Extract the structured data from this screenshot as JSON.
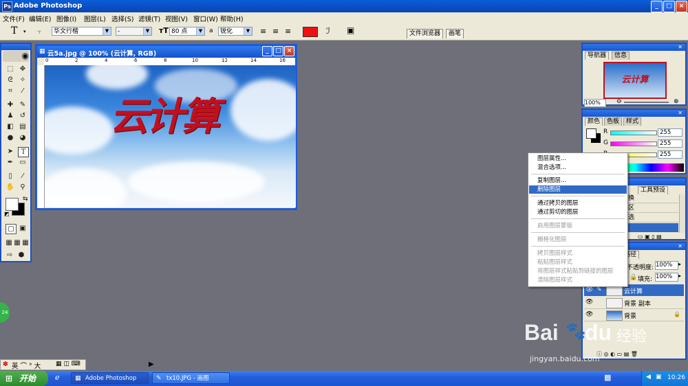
{
  "app": {
    "title": "Adobe Photoshop",
    "window_buttons": [
      "_",
      "□",
      "×"
    ]
  },
  "menu": [
    "文件(F)",
    "编辑(E)",
    "图像(I)",
    "图层(L)",
    "选择(S)",
    "滤镜(T)",
    "视图(V)",
    "窗口(W)",
    "帮助(H)"
  ],
  "options": {
    "tool_glyph": "T",
    "font_family": "华文行楷",
    "font_style": "-",
    "font_size": "80 点",
    "aa_label": "a",
    "antialias": "锐化",
    "text_color": "#ee1111",
    "file_browser": "文件浏览器",
    "brushes": "画笔"
  },
  "document": {
    "title": "云5a.jpg @ 100% (云计算, RGB)",
    "ruler_marks": [
      "0",
      "2",
      "4",
      "6",
      "8",
      "10",
      "12",
      "14",
      "16"
    ],
    "canvas_text": "云计算"
  },
  "navigator": {
    "tabs": [
      "导航器",
      "信息"
    ],
    "zoom": "100%",
    "preview_text": "云计算"
  },
  "color_panel": {
    "tabs": [
      "颜色",
      "色板",
      "样式"
    ],
    "channels": [
      {
        "label": "R",
        "value": "255"
      },
      {
        "label": "G",
        "value": "255"
      },
      {
        "label": "B",
        "value": "255"
      }
    ]
  },
  "history_panel": {
    "tabs": [
      "工具预设"
    ],
    "items": [
      "换",
      "区",
      "选"
    ]
  },
  "layers_panel": {
    "tab": "路径",
    "opacity_label": "不透明度:",
    "opacity": "100%",
    "fill_label": "填充:",
    "fill": "100%",
    "layers": [
      {
        "name": "云计算",
        "selected": true
      },
      {
        "name": "背景 副本",
        "selected": false
      },
      {
        "name": "背景",
        "selected": false
      }
    ]
  },
  "context_menu": {
    "items": [
      {
        "label": "图层属性...",
        "disabled": false
      },
      {
        "label": "混合选项...",
        "disabled": false
      },
      {
        "label": "复制图层...",
        "disabled": false
      },
      {
        "label": "删除图层",
        "disabled": false,
        "selected": true
      },
      {
        "label": "通过拷贝的图层",
        "disabled": false
      },
      {
        "label": "通过剪切的图层",
        "disabled": false
      },
      {
        "label": "启用图层蒙版",
        "disabled": true
      },
      {
        "label": "栅格化图层",
        "disabled": true
      },
      {
        "label": "拷贝图层样式",
        "disabled": true
      },
      {
        "label": "粘贴图层样式",
        "disabled": true
      },
      {
        "label": "将图层样式粘贴到链接的图层",
        "disabled": true
      },
      {
        "label": "清除图层样式",
        "disabled": true
      }
    ]
  },
  "ime": {
    "text": "英 ⌒ ° 大",
    "badge": "24"
  },
  "taskbar": {
    "start": "开始",
    "tasks": [
      "Adobe Photoshop",
      "tx10.JPG - 画图"
    ],
    "time": "10:26"
  },
  "watermark": {
    "brand": "Bai",
    "brand2": "du",
    "cn": "经验",
    "url": "jingyan.baidu.com"
  }
}
